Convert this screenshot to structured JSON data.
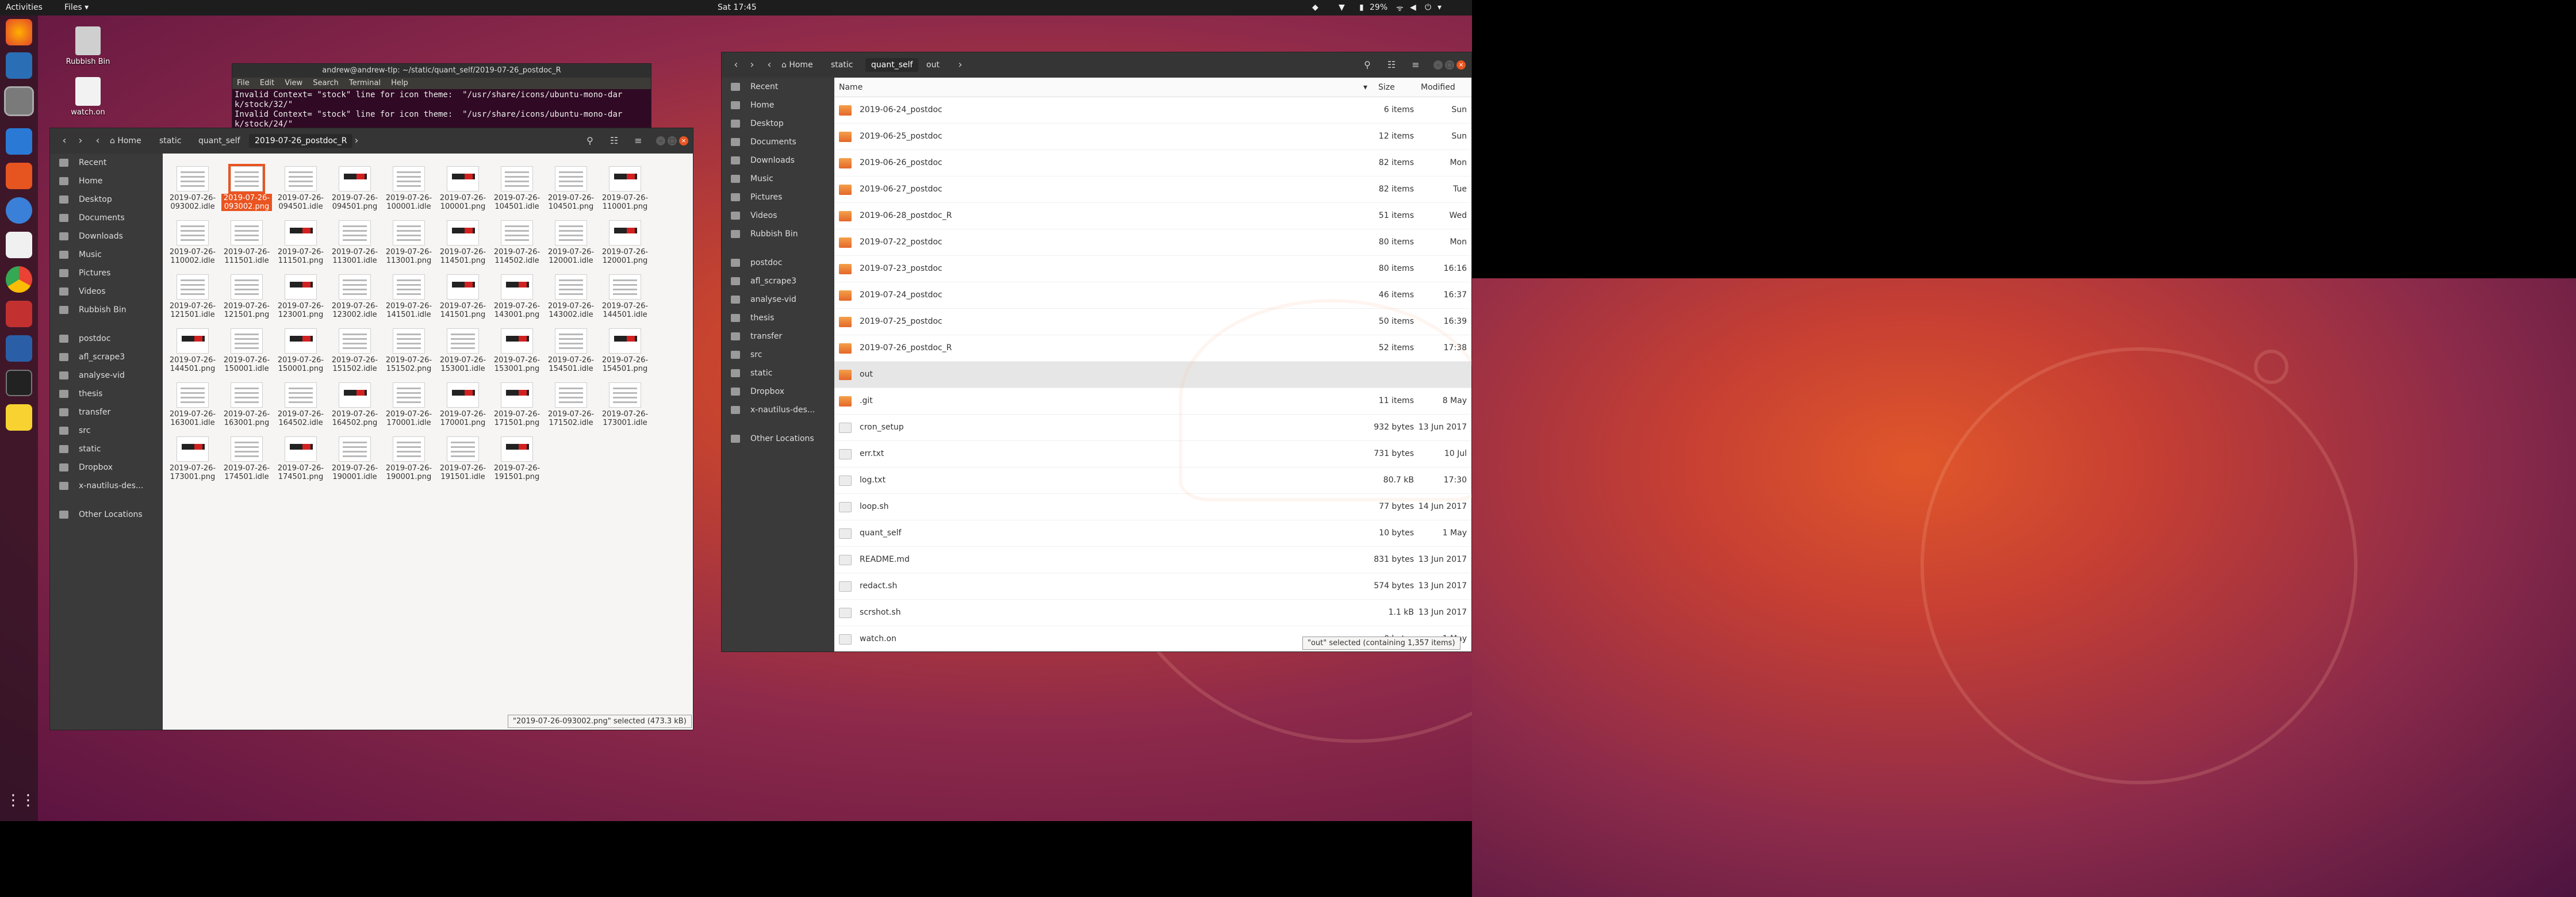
{
  "topbar": {
    "activities": "Activities",
    "app_menu": "Files ▾",
    "clock": "Sat 17:45",
    "battery": "29%"
  },
  "desktop_icons": [
    {
      "label": "Rubbish Bin"
    },
    {
      "label": "watch.on"
    }
  ],
  "terminal": {
    "title": "andrew@andrew-tlp: ~/static/quant_self/2019-07-26_postdoc_R",
    "menu": [
      "File",
      "Edit",
      "View",
      "Search",
      "Terminal",
      "Help"
    ],
    "lines": [
      "Invalid Context= \"stock\" line for icon theme:  \"/usr/share/icons/ubuntu-mono-dar",
      "k/stock/32/\"",
      "Invalid Context= \"stock\" line for icon theme:  \"/usr/share/icons/ubuntu-mono-dar",
      "k/stock/24/\""
    ]
  },
  "left_window": {
    "breadcrumbs": [
      "Home",
      "static",
      "quant_self",
      "2019-07-26_postdoc_R"
    ],
    "sidebar": [
      "Recent",
      "Home",
      "Desktop",
      "Documents",
      "Downloads",
      "Music",
      "Pictures",
      "Videos",
      "Rubbish Bin",
      "",
      "postdoc",
      "afl_scrape3",
      "analyse-vid",
      "thesis",
      "transfer",
      "src",
      "static",
      "Dropbox",
      "x-nautilus-des...",
      "",
      "Other Locations"
    ],
    "files": [
      [
        "2019-07-26-",
        "093002.idle"
      ],
      [
        "2019-07-26-",
        "093002.png"
      ],
      [
        "2019-07-26-",
        "094501.idle"
      ],
      [
        "2019-07-26-",
        "094501.png"
      ],
      [
        "2019-07-26-",
        "100001.idle"
      ],
      [
        "2019-07-26-",
        "100001.png"
      ],
      [
        "2019-07-26-",
        "104501.idle"
      ],
      [
        "2019-07-26-",
        "104501.png"
      ],
      [
        "2019-07-26-",
        "110001.png"
      ],
      [
        "2019-07-26-",
        "110002.idle"
      ],
      [
        "2019-07-26-",
        "111501.idle"
      ],
      [
        "2019-07-26-",
        "111501.png"
      ],
      [
        "2019-07-26-",
        "113001.idle"
      ],
      [
        "2019-07-26-",
        "113001.png"
      ],
      [
        "2019-07-26-",
        "114501.png"
      ],
      [
        "2019-07-26-",
        "114502.idle"
      ],
      [
        "2019-07-26-",
        "120001.idle"
      ],
      [
        "2019-07-26-",
        "120001.png"
      ],
      [
        "2019-07-26-",
        "121501.idle"
      ],
      [
        "2019-07-26-",
        "121501.png"
      ],
      [
        "2019-07-26-",
        "123001.png"
      ],
      [
        "2019-07-26-",
        "123002.idle"
      ],
      [
        "2019-07-26-",
        "141501.idle"
      ],
      [
        "2019-07-26-",
        "141501.png"
      ],
      [
        "2019-07-26-",
        "143001.png"
      ],
      [
        "2019-07-26-",
        "143002.idle"
      ],
      [
        "2019-07-26-",
        "144501.idle"
      ],
      [
        "2019-07-26-",
        "144501.png"
      ],
      [
        "2019-07-26-",
        "150001.idle"
      ],
      [
        "2019-07-26-",
        "150001.png"
      ],
      [
        "2019-07-26-",
        "151502.idle"
      ],
      [
        "2019-07-26-",
        "151502.png"
      ],
      [
        "2019-07-26-",
        "153001.idle"
      ],
      [
        "2019-07-26-",
        "153001.png"
      ],
      [
        "2019-07-26-",
        "154501.idle"
      ],
      [
        "2019-07-26-",
        "154501.png"
      ],
      [
        "2019-07-26-",
        "163001.idle"
      ],
      [
        "2019-07-26-",
        "163001.png"
      ],
      [
        "2019-07-26-",
        "164502.idle"
      ],
      [
        "2019-07-26-",
        "164502.png"
      ],
      [
        "2019-07-26-",
        "170001.idle"
      ],
      [
        "2019-07-26-",
        "170001.png"
      ],
      [
        "2019-07-26-",
        "171501.png"
      ],
      [
        "2019-07-26-",
        "171502.idle"
      ],
      [
        "2019-07-26-",
        "173001.idle"
      ],
      [
        "2019-07-26-",
        "173001.png"
      ],
      [
        "2019-07-26-",
        "174501.idle"
      ],
      [
        "2019-07-26-",
        "174501.png"
      ],
      [
        "2019-07-26-",
        "190001.idle"
      ],
      [
        "2019-07-26-",
        "190001.png"
      ],
      [
        "2019-07-26-",
        "191501.idle"
      ],
      [
        "2019-07-26-",
        "191501.png"
      ]
    ],
    "selected_index": 1,
    "status": "\"2019-07-26-093002.png\" selected (473.3 kB)"
  },
  "right_window": {
    "breadcrumbs": [
      "Home",
      "static",
      "quant_self",
      "out"
    ],
    "sidebar": [
      "Recent",
      "Home",
      "Desktop",
      "Documents",
      "Downloads",
      "Music",
      "Pictures",
      "Videos",
      "Rubbish Bin",
      "",
      "postdoc",
      "afl_scrape3",
      "analyse-vid",
      "thesis",
      "transfer",
      "src",
      "static",
      "Dropbox",
      "x-nautilus-des...",
      "",
      "Other Locations"
    ],
    "columns": {
      "name": "Name",
      "size": "Size",
      "modified": "Modified"
    },
    "rows": [
      {
        "name": "2019-06-24_postdoc",
        "size": "6 items",
        "modified": "Sun",
        "type": "folder"
      },
      {
        "name": "2019-06-25_postdoc",
        "size": "12 items",
        "modified": "Sun",
        "type": "folder"
      },
      {
        "name": "2019-06-26_postdoc",
        "size": "82 items",
        "modified": "Mon",
        "type": "folder"
      },
      {
        "name": "2019-06-27_postdoc",
        "size": "82 items",
        "modified": "Tue",
        "type": "folder"
      },
      {
        "name": "2019-06-28_postdoc_R",
        "size": "51 items",
        "modified": "Wed",
        "type": "folder"
      },
      {
        "name": "2019-07-22_postdoc",
        "size": "80 items",
        "modified": "Mon",
        "type": "folder"
      },
      {
        "name": "2019-07-23_postdoc",
        "size": "80 items",
        "modified": "16:16",
        "type": "folder"
      },
      {
        "name": "2019-07-24_postdoc",
        "size": "46 items",
        "modified": "16:37",
        "type": "folder"
      },
      {
        "name": "2019-07-25_postdoc",
        "size": "50 items",
        "modified": "16:39",
        "type": "folder"
      },
      {
        "name": "2019-07-26_postdoc_R",
        "size": "52 items",
        "modified": "17:38",
        "type": "folder"
      },
      {
        "name": "out",
        "size": "",
        "modified": "",
        "type": "folder"
      },
      {
        "name": ".git",
        "size": "11 items",
        "modified": "8 May",
        "type": "folder"
      },
      {
        "name": "cron_setup",
        "size": "932 bytes",
        "modified": "13 Jun 2017",
        "type": "file"
      },
      {
        "name": "err.txt",
        "size": "731 bytes",
        "modified": "10 Jul",
        "type": "file"
      },
      {
        "name": "log.txt",
        "size": "80.7 kB",
        "modified": "17:30",
        "type": "file"
      },
      {
        "name": "loop.sh",
        "size": "77 bytes",
        "modified": "14 Jun 2017",
        "type": "file"
      },
      {
        "name": "quant_self",
        "size": "10 bytes",
        "modified": "1 May",
        "type": "file"
      },
      {
        "name": "README.md",
        "size": "831 bytes",
        "modified": "13 Jun 2017",
        "type": "file"
      },
      {
        "name": "redact.sh",
        "size": "574 bytes",
        "modified": "13 Jun 2017",
        "type": "file"
      },
      {
        "name": "scrshot.sh",
        "size": "1.1 kB",
        "modified": "13 Jun 2017",
        "type": "file"
      },
      {
        "name": "watch.on",
        "size": "0 bytes",
        "modified": "1 May",
        "type": "file"
      }
    ],
    "selected_row": 10,
    "status": "\"out\" selected  (containing 1,357 items)"
  }
}
